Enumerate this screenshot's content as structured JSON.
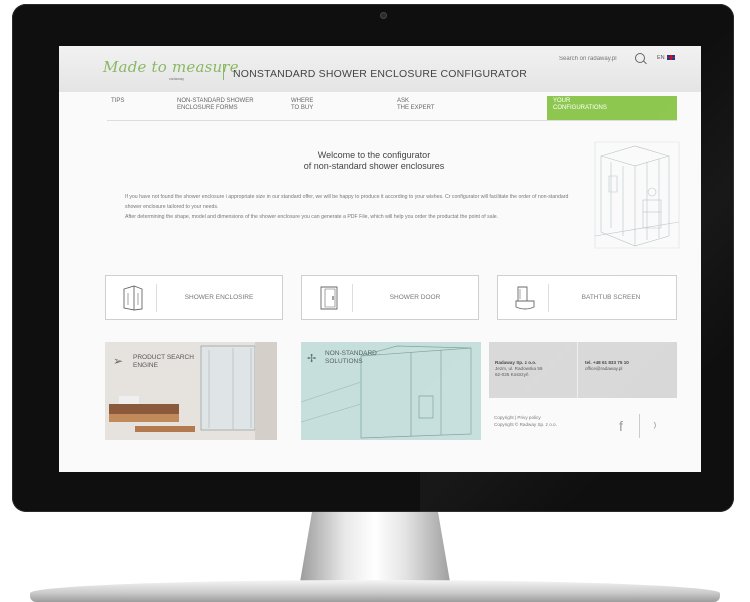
{
  "header": {
    "logo": "Made to measure",
    "logo_sub": "radaway",
    "title": "NONSTANDARD SHOWER ENCLOSURE CONFIGURATOR",
    "search_placeholder": "Search on radaway.pl",
    "lang": "EN"
  },
  "nav": {
    "items": [
      {
        "label": "TIPS"
      },
      {
        "label": "NON-STANDARD SHOWER\nENCLOSURE FORMS"
      },
      {
        "label": "WHERE\nTO BUY"
      },
      {
        "label": "ASK\nTHE EXPERT"
      },
      {
        "label": "YOUR\nCONFIGURATIONS"
      }
    ],
    "active_color": "#8ec74f"
  },
  "welcome": {
    "title": "Welcome to the configurator\nof non-standard shower enclosures",
    "paragraph1": "If you have not found the shower enclosure i appropriate size in our standard offer, we will be happy to produce it according to your wishes. Cr configurator will facilitate the order of non-standard shower enclosure tailored to your needs.",
    "paragraph2": "After determining the shape, model and dimensions of the shower enclosure you can generate a PDF File, which will help you order the productat the point of sale."
  },
  "products": [
    {
      "label": "SHOWER ENCLOSIRE",
      "icon": "shower-enclosure-icon"
    },
    {
      "label": "SHOWER DOOR",
      "icon": "shower-door-icon"
    },
    {
      "label": "BATHTUB SCREEN",
      "icon": "bathtub-screen-icon"
    }
  ],
  "tiles": {
    "product_search": "PRODUCT SEARCH\nENGINE",
    "non_standard": "NON-STANDARD\nSOLUTIONS"
  },
  "contact": {
    "company": "Radaway Sp. z o.o.",
    "address_line1": "Jezm, ul. Radowska 59",
    "address_line2": "62-025 Kostrzyń",
    "phone": "tel. +48 61 833 75 10",
    "email": "office@radaway.pl"
  },
  "footer": {
    "links": "Copyright  |  Privy policy",
    "copyright": "Copyright © Radway Sp. z o.o."
  },
  "colors": {
    "accent_green": "#8ec74f",
    "logo_green": "#8ab864"
  }
}
